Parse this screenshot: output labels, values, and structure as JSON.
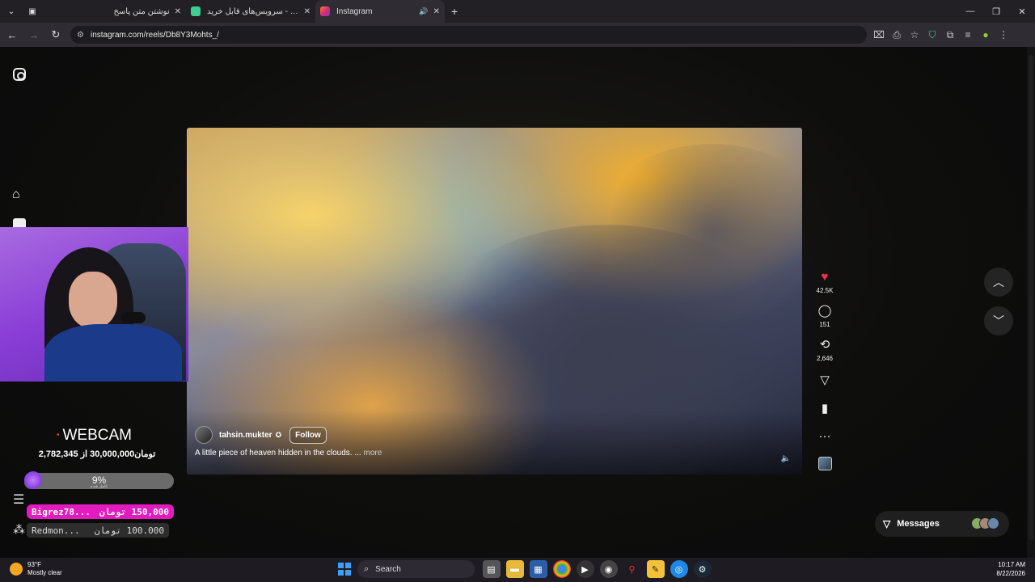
{
  "browser": {
    "tabs": [
      {
        "title": "نوشتن متن پاسخ",
        "active": false,
        "favicon_color": "#d0d0d0"
      },
      {
        "title": "سرویس‌های قابل خرید - Connect",
        "active": false,
        "favicon_color": "#3ecf8e"
      },
      {
        "title": "Instagram",
        "active": true,
        "favicon_color": "#e1306c"
      }
    ],
    "new_tab": "+",
    "url": "instagram.com/reels/Db8Y3Mohts_/"
  },
  "instagram": {
    "reel": {
      "username": "tahsin.mukter",
      "follow_label": "Follow",
      "caption": "A little piece of heaven hidden in the clouds. ...",
      "more_label": "more"
    },
    "actions": {
      "likes": "42.5K",
      "comments": "151",
      "reposts": "2,646"
    },
    "messages_label": "Messages"
  },
  "overlay": {
    "webcam_label": "WEBCAM",
    "donation_goal": "تومان30,000,000 از 2,782,345",
    "progress_percent": "9%",
    "progress_value": 0.09,
    "progress_sub": "کامل شده",
    "donors": [
      {
        "name": "Bigrez78...",
        "amount": "150,000 تومان"
      },
      {
        "name": "Redmon...",
        "amount": "100.000 تومان"
      }
    ]
  },
  "taskbar": {
    "temperature": "93°F",
    "weather": "Mostly clear",
    "search_label": "Search",
    "time": "10:17 AM",
    "date": "8/22/2026"
  },
  "colors": {
    "like_red": "#ff2d55",
    "donor_highlight": "#e21bbf",
    "overlay_purple": "#8a3ed6"
  }
}
